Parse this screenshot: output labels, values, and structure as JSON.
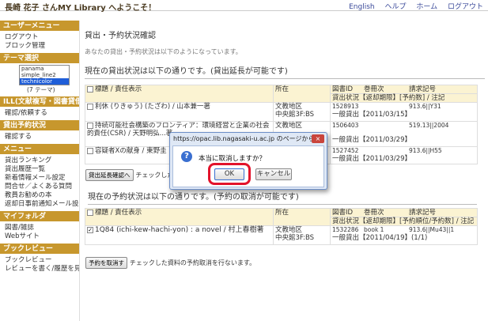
{
  "topbar": {
    "greeting": "長崎 花子 さんMY Library へようこそ！",
    "links": [
      "English",
      "ヘルプ",
      "ホーム",
      "ログアウト"
    ]
  },
  "sidebar": {
    "user_menu": {
      "title": "ユーザーメニュー",
      "items": [
        "ログアウト",
        "ブロック管理"
      ]
    },
    "theme": {
      "title": "テーマ選択",
      "options": [
        "panama",
        "simple_line2",
        "technicolor"
      ],
      "selected": "technicolor",
      "caption": "(7 テーマ)"
    },
    "ill": {
      "title": "ILL(文献複写・図書貸借)",
      "items": [
        "確認/依頼する"
      ]
    },
    "loan": {
      "title": "貸出予約状況",
      "items": [
        "確認する"
      ]
    },
    "menu": {
      "title": "メニュー",
      "items": [
        "貸出ランキング",
        "貸出履歴一覧",
        "新着情報メール設定",
        "問合せ／よくある質問",
        "教員お勧めの本",
        "返却日事前通知メール設定"
      ]
    },
    "my_folder": {
      "title": "マイフォルダ",
      "items": [
        "図書/雑誌",
        "Webサイト"
      ]
    },
    "review": {
      "title": "ブックレビュー",
      "items": [
        "ブックレビュー",
        "レビューを書く/履歴を見る"
      ]
    }
  },
  "main": {
    "title": "貸出・予約状況確認",
    "subtitle": "あなたの貸出・予約状況は以下のようになっています。",
    "loans_section": {
      "heading": "現在の貸出状況は以下の通りです。(貸出延長が可能です)",
      "headers": {
        "title": "標題 / 責任表示",
        "location": "所在",
        "id": "図書ID",
        "volume": "巻冊次",
        "callno": "請求記号",
        "status": "貸出状況【返却期限】[予約数] / 注記"
      },
      "rows": [
        {
          "title": "利休 (りきゅう) (たざわ) / 山本兼一著",
          "loc1": "文教地区",
          "loc2": "中央館3F:BS",
          "id": "1528913",
          "volume": "",
          "callno": "913.6||Y31",
          "status": "一般貸出【2011/03/15】"
        },
        {
          "title": "持続可能社会構築のフロンティア：環境経営と企業の社会的責任(CSR) / 天野明弘...著",
          "loc1": "文教地区",
          "loc2": "",
          "id": "1506403",
          "volume": "",
          "callno": "519.13||2004",
          "status": "一般貸出【2011/03/29】"
        },
        {
          "title": "容疑者Xの献身 / 東野圭",
          "loc1": "",
          "loc2": "",
          "id": "1527452",
          "volume": "",
          "callno": "913.6||H55",
          "status": "一般貸出【2011/03/29】"
        }
      ],
      "button": "貸出延長確認へ",
      "note": "チェックした"
    },
    "reserve_section": {
      "heading": "現在の予約状況は以下の通りです。(予約の取消が可能です)",
      "headers": {
        "title": "標題 / 責任表示",
        "location": "所在",
        "id": "図書ID",
        "volume": "巻冊次",
        "callno": "請求記号",
        "status": "貸出状況【返却期限】[予約順位/予約数] / 注記"
      },
      "rows": [
        {
          "title": "1Q84 (ichi-kew-hachi-yon) : a novel / 村上春樹著",
          "loc1": "文教地区",
          "loc2": "中央館3F:BS",
          "id": "1532286",
          "volume": "book 1",
          "callno": "913.6||Mu43||1",
          "status": "一般貸出【2011/04/19】(1/1)"
        }
      ],
      "button": "予約を取消す",
      "note": "チェックした資料の予約取消を行ないます。"
    }
  },
  "dialog": {
    "title": "https://opac.lib.nagasaki-u.ac.jp のページから：",
    "message": "本当に取消しますか？",
    "ok": "OK",
    "cancel": "キャンセル",
    "close": "×"
  },
  "colors": {
    "accent": "#c7972d",
    "header_row": "#fbf3d2",
    "highlight": "#e3132b",
    "link": "#3b4a9a"
  }
}
